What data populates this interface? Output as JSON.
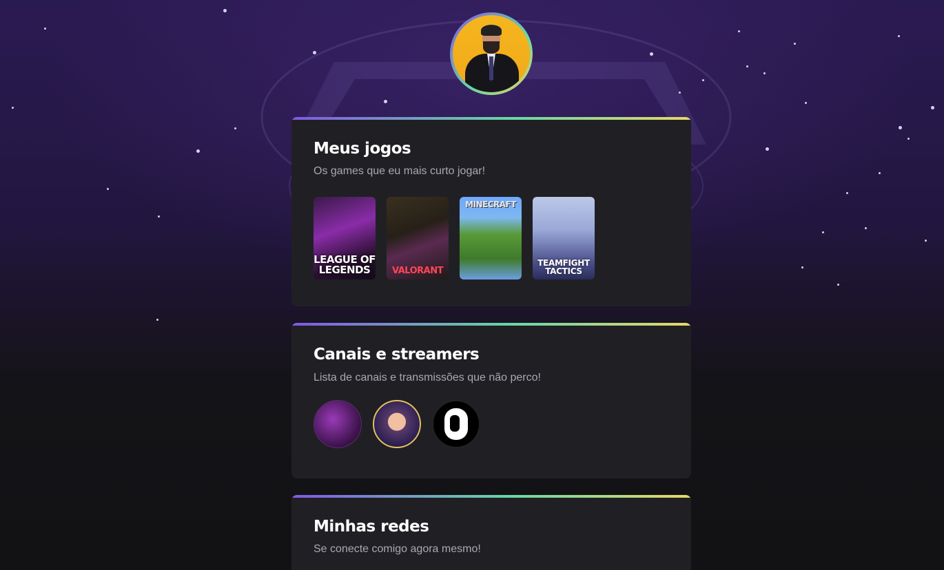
{
  "profile": {
    "avatar_icon": "profile-photo"
  },
  "colors": {
    "background": "#121214",
    "card": "#202024",
    "accent_start": "#8257e5",
    "accent_mid": "#68d8a6",
    "accent_end": "#e8d868",
    "subtitle": "#a8a8b3"
  },
  "sections": {
    "games": {
      "title": "Meus jogos",
      "subtitle": "Os games que eu mais curto jogar!",
      "items": [
        {
          "label": "LEAGUE OF LEGENDS"
        },
        {
          "label": "VALORANT"
        },
        {
          "label": "MINECRAFT"
        },
        {
          "label": "TEAMFIGHT TACTICS"
        }
      ]
    },
    "streamers": {
      "title": "Canais e streamers",
      "subtitle": "Lista de canais e transmissões que não perco!",
      "items": [
        {
          "icon": "streamer-avatar-1"
        },
        {
          "icon": "streamer-avatar-2"
        },
        {
          "icon": "streamer-avatar-3"
        }
      ]
    },
    "networks": {
      "title": "Minhas redes",
      "subtitle": "Se conecte comigo agora mesmo!"
    }
  }
}
